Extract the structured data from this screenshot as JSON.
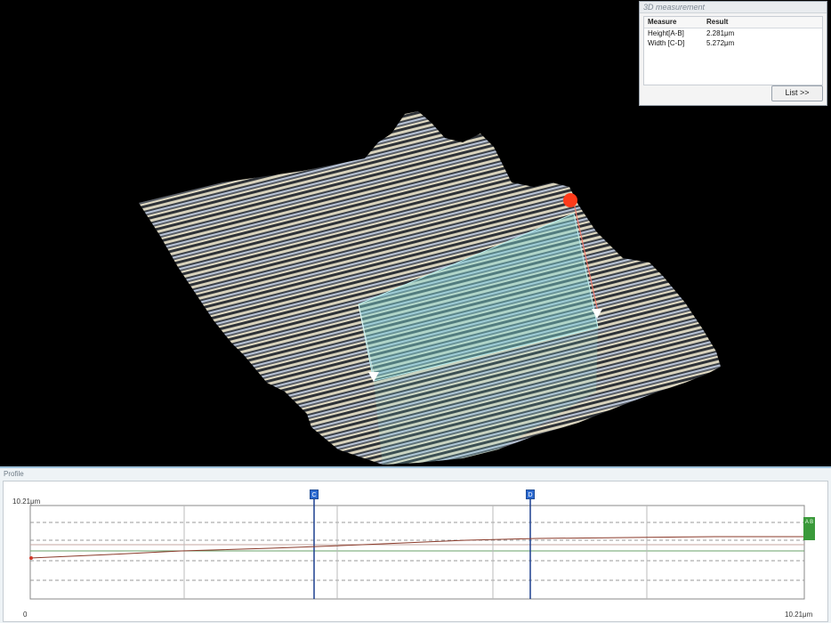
{
  "measurement_panel": {
    "title": "3D measurement",
    "columns": [
      "Measure",
      "Result"
    ],
    "rows": [
      {
        "measure": "Height[A-B]",
        "result": "2.281μm"
      },
      {
        "measure": "Width [C-D]",
        "result": "5.272μm"
      }
    ],
    "list_button": "List >>"
  },
  "profile_panel": {
    "title": "Profile",
    "y_max_label": "10.21μm",
    "x_origin_label": "0",
    "x_max_label": "10.21μm",
    "cursor_c_label": "C",
    "cursor_d_label": "D",
    "side_tag_label": "A B"
  },
  "colors": {
    "background": "#000000",
    "selection_plane": "#7fd6d6",
    "point_marker": "#ff3b1a",
    "cursor": "#2d6bd1",
    "profile_line": "#8a3a2a"
  }
}
